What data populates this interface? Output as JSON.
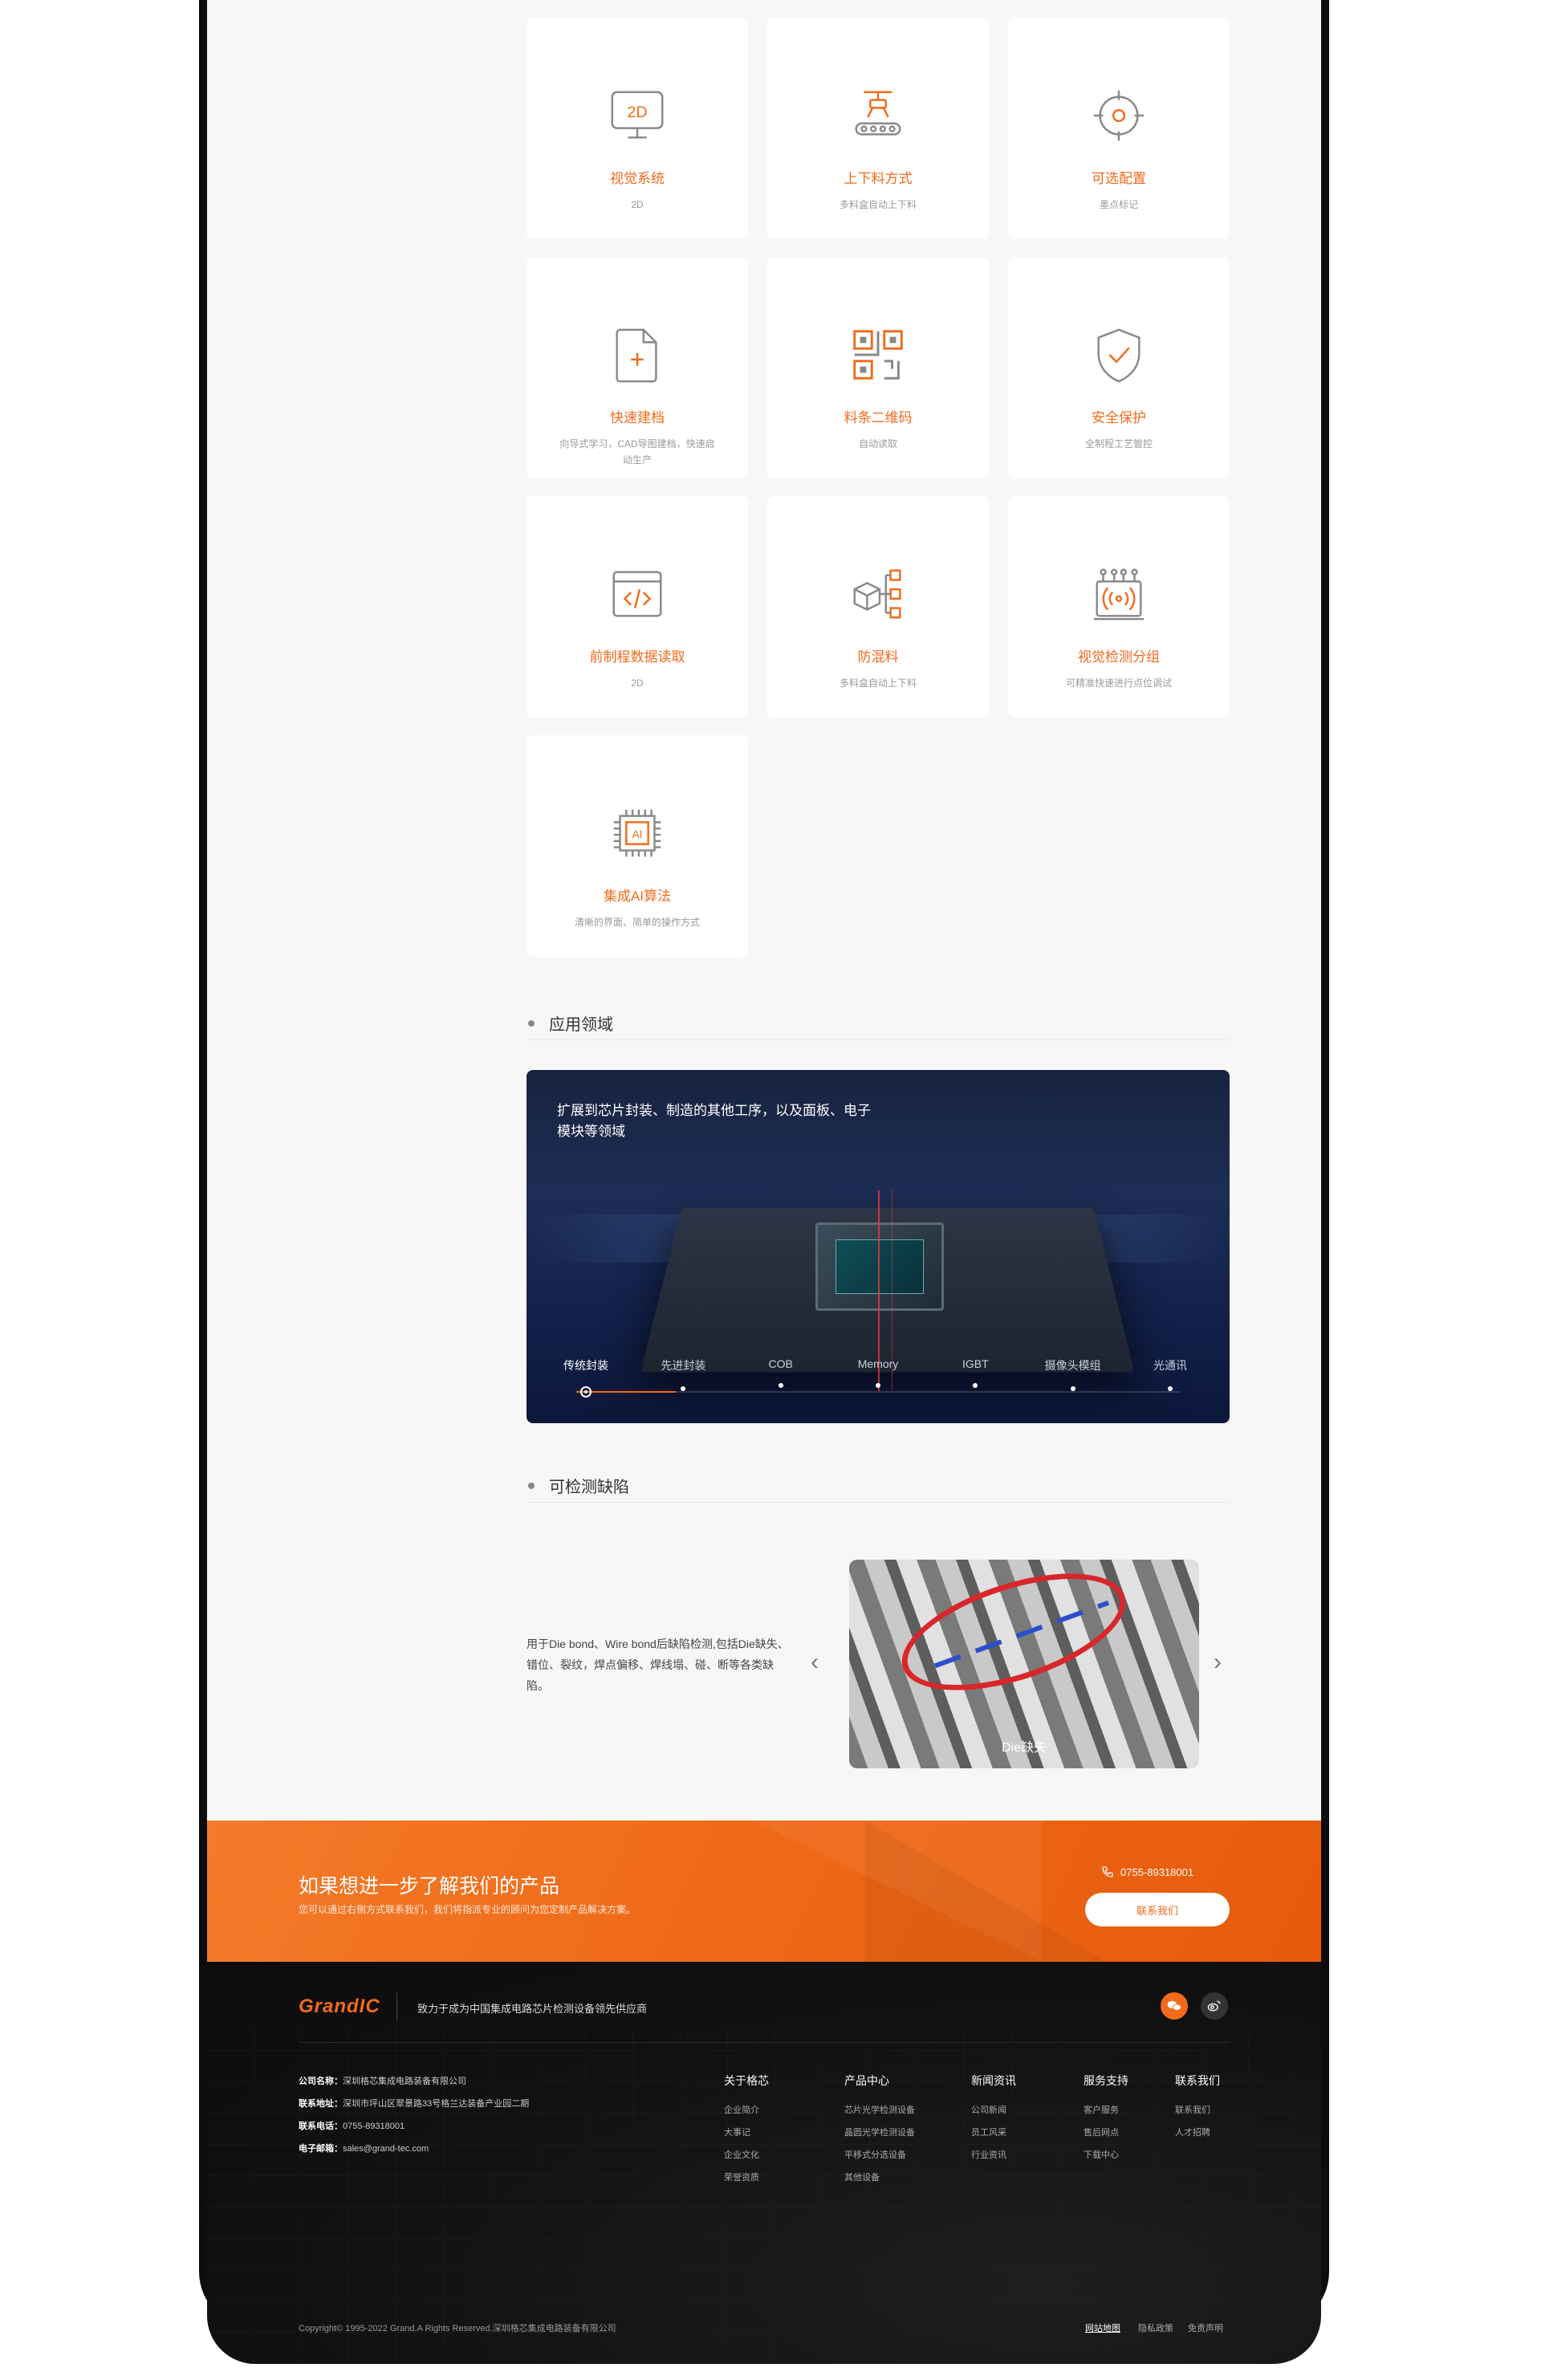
{
  "features": [
    {
      "title": "视觉系统",
      "sub": "2D",
      "icon": "monitor-2d-icon"
    },
    {
      "title": "上下料方式",
      "sub": "多料盒自动上下料",
      "icon": "robot-arm-conveyor-icon"
    },
    {
      "title": "可选配置",
      "sub": "墨点标记",
      "icon": "target-icon"
    },
    {
      "title": "快速建档",
      "sub": "向导式学习，CAD导图建档，快速启动生产",
      "icon": "file-add-icon"
    },
    {
      "title": "料条二维码",
      "sub": "自动读取",
      "icon": "qr-code-icon"
    },
    {
      "title": "安全保护",
      "sub": "全制程工艺管控",
      "icon": "shield-check-icon"
    },
    {
      "title": "前制程数据读取",
      "sub": "2D",
      "icon": "code-window-icon"
    },
    {
      "title": "防混料",
      "sub": "多料盒自动上下料",
      "icon": "cube-network-icon"
    },
    {
      "title": "视觉检测分组",
      "sub": "可精准快速进行点位调试",
      "icon": "wireless-device-icon"
    },
    {
      "title": "集成AI算法",
      "sub": "清晰的界面、简单的操作方式",
      "icon": "ai-chip-icon"
    }
  ],
  "icon_2d_text": "2D",
  "icon_ai_text": "AI",
  "application": {
    "heading": "应用领域",
    "caption": "扩展到芯片封装、制造的其他工序，以及面板、电子模块等领域",
    "tabs": [
      "传统封装",
      "先进封装",
      "COB",
      "Memory",
      "IGBT",
      "摄像头模组",
      "光通讯"
    ],
    "active_tab": 0
  },
  "defects": {
    "heading": "可检测缺陷",
    "text": "用于Die bond、Wire bond后缺陷检测,包括Die缺失、错位、裂纹，焊点偏移、焊线塌、碰、断等各类缺陷。",
    "image_caption": "Die缺失",
    "prev": "‹",
    "next": "›"
  },
  "cta": {
    "title": "如果想进一步了解我们的产品",
    "subtitle": "您可以通过右侧方式联系我们，我们将指派专业的顾问为您定制产品解决方案。",
    "phone": "0755-89318001",
    "button": "联系我们"
  },
  "footer": {
    "logo": "GrandIC",
    "slogan": "致力于成为中国集成电路芯片检测设备领先供应商",
    "info": [
      {
        "label": "公司名称：",
        "value": "深圳格芯集成电路装备有限公司"
      },
      {
        "label": "联系地址：",
        "value": "深圳市坪山区翠景路33号格兰达装备产业园二期"
      },
      {
        "label": "联系电话：",
        "value": "0755-89318001"
      },
      {
        "label": "电子邮箱：",
        "value": "sales@grand-tec.com"
      }
    ],
    "columns": [
      {
        "head": "关于格芯",
        "items": [
          "企业简介",
          "大事记",
          "企业文化",
          "荣誉资质"
        ]
      },
      {
        "head": "产品中心",
        "items": [
          "芯片光学检测设备",
          "晶圆光学检测设备",
          "平移式分选设备",
          "其他设备"
        ]
      },
      {
        "head": "新闻资讯",
        "items": [
          "公司新闻",
          "员工风采",
          "行业资讯"
        ]
      },
      {
        "head": "服务支持",
        "items": [
          "客户服务",
          "售后网点",
          "下载中心"
        ]
      },
      {
        "head": "联系我们",
        "items": [
          "联系我们",
          "人才招聘"
        ]
      }
    ],
    "copyright": "Copyright© 1995-2022 Grand.A Rights Reserved.深圳格芯集成电路装备有限公司",
    "legal": [
      "网站地图",
      "隐私政策",
      "免责声明"
    ]
  },
  "colors": {
    "accent": "#f26a1b",
    "card_text_muted": "#9a9a9a"
  }
}
